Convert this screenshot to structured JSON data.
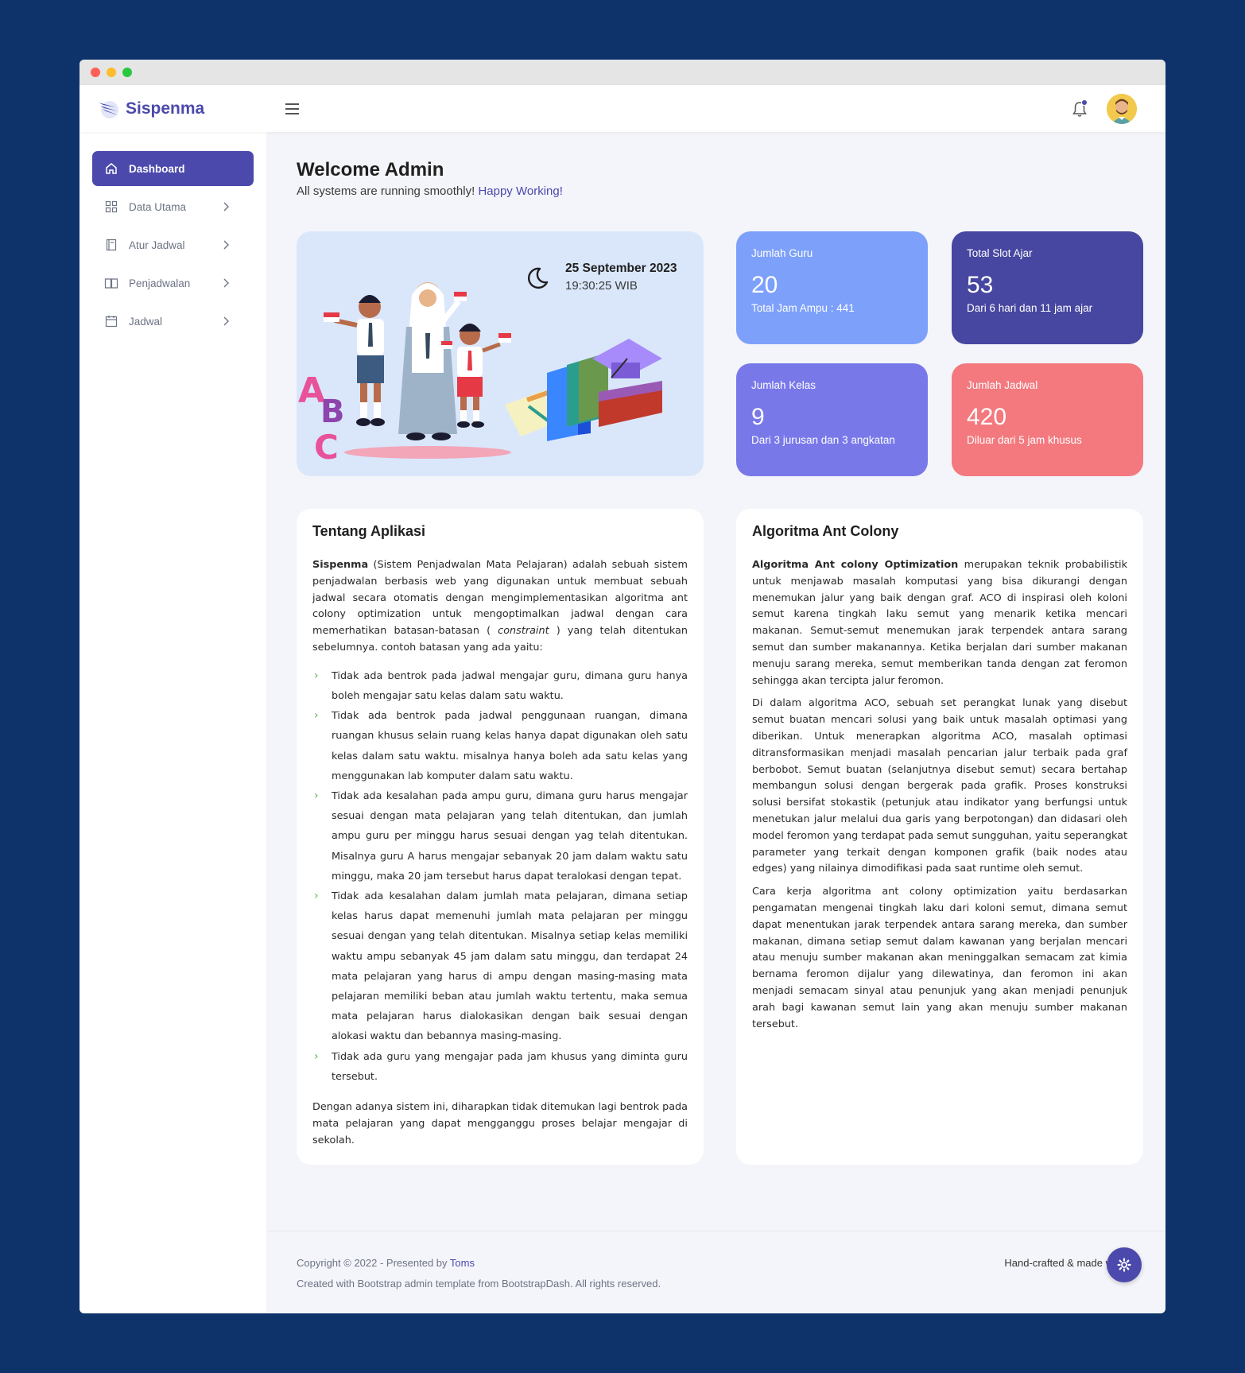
{
  "brand": {
    "name": "Sispenma"
  },
  "sidebar": {
    "items": [
      {
        "label": "Dashboard",
        "icon": "home-icon",
        "active": true
      },
      {
        "label": "Data Utama",
        "icon": "grid-icon"
      },
      {
        "label": "Atur Jadwal",
        "icon": "book-icon"
      },
      {
        "label": "Penjadwalan",
        "icon": "open-book-icon"
      },
      {
        "label": "Jadwal",
        "icon": "calendar-icon"
      }
    ]
  },
  "welcome": {
    "title": "Welcome Admin",
    "subtitle": "All systems are running smoothly!",
    "highlight": "Happy Working!"
  },
  "hero": {
    "date": "25 September 2023",
    "time": "19:30:25 WIB"
  },
  "stats": [
    {
      "label": "Jumlah Guru",
      "value": "20",
      "sub": "Total Jam Ampu : 441",
      "color": "#7da0fa"
    },
    {
      "label": "Total Slot Ajar",
      "value": "53",
      "sub": "Dari 6 hari dan 11 jam ajar",
      "color": "#4747a1"
    },
    {
      "label": "Jumlah Kelas",
      "value": "9",
      "sub": "Dari 3 jurusan dan 3 angkatan",
      "color": "#7978e9"
    },
    {
      "label": "Jumlah Jadwal",
      "value": "420",
      "sub": "Diluar dari 5 jam khusus",
      "color": "#f3797e"
    }
  ],
  "about": {
    "title": "Tentang Aplikasi",
    "intro_bold": "Sispenma",
    "intro_a": " (Sistem Penjadwalan Mata Pelajaran) adalah sebuah sistem penjadwalan berbasis web yang digunakan untuk membuat sebuah jadwal secara otomatis dengan mengimplementasikan algoritma ant colony optimization untuk mengoptimalkan jadwal dengan cara memerhatikan batasan-batasan ( ",
    "intro_italic": "constraint",
    "intro_b": " ) yang telah ditentukan sebelumnya. contoh batasan yang ada yaitu:",
    "list": [
      "Tidak ada bentrok pada jadwal mengajar guru, dimana guru hanya boleh mengajar satu kelas dalam satu waktu.",
      "Tidak ada bentrok pada jadwal penggunaan ruangan, dimana ruangan khusus selain ruang kelas hanya dapat digunakan oleh satu kelas dalam satu waktu. misalnya hanya boleh ada satu kelas yang menggunakan lab komputer dalam satu waktu.",
      "Tidak ada kesalahan pada ampu guru, dimana guru harus mengajar sesuai dengan mata pelajaran yang telah ditentukan, dan jumlah ampu guru per minggu harus sesuai dengan yag telah ditentukan. Misalnya guru A harus mengajar sebanyak 20 jam dalam waktu satu minggu, maka 20 jam tersebut harus dapat teralokasi dengan tepat.",
      "Tidak ada kesalahan dalam jumlah mata pelajaran, dimana setiap kelas harus dapat memenuhi jumlah mata pelajaran per minggu sesuai dengan yang telah ditentukan. Misalnya setiap kelas memiliki waktu ampu sebanyak 45 jam dalam satu minggu, dan terdapat 24 mata pelajaran yang harus di ampu dengan masing-masing mata pelajaran memiliki beban atau jumlah waktu tertentu, maka semua mata pelajaran harus dialokasikan dengan baik sesuai dengan alokasi waktu dan bebannya masing-masing.",
      "Tidak ada guru yang mengajar pada jam khusus yang diminta guru tersebut."
    ],
    "closing": "Dengan adanya sistem ini, diharapkan tidak ditemukan lagi bentrok pada mata pelajaran yang dapat mengganggu proses belajar mengajar di sekolah."
  },
  "aco": {
    "title": "Algoritma Ant Colony",
    "p1_bold": "Algoritma Ant colony Optimization",
    "p1": " merupakan teknik probabilistik untuk menjawab masalah komputasi yang bisa dikurangi dengan menemukan jalur yang baik dengan graf. ACO di inspirasi oleh koloni semut karena tingkah laku semut yang menarik ketika mencari makanan. Semut-semut menemukan jarak terpendek antara sarang semut dan sumber makanannya. Ketika berjalan dari sumber makanan menuju sarang mereka, semut memberikan tanda dengan zat feromon sehingga akan tercipta jalur feromon.",
    "p2": "Di dalam algoritma ACO, sebuah set perangkat lunak yang disebut semut buatan mencari solusi yang baik untuk masalah optimasi yang diberikan. Untuk menerapkan algoritma ACO, masalah optimasi ditransformasikan menjadi masalah pencarian jalur terbaik pada graf berbobot. Semut buatan (selanjutnya disebut semut) secara bertahap membangun solusi dengan bergerak pada grafik. Proses konstruksi solusi bersifat stokastik (petunjuk atau indikator yang berfungsi untuk menetukan jalur melalui dua garis yang berpotongan) dan didasari oleh model feromon yang terdapat pada semut sungguhan, yaitu seperangkat parameter yang terkait dengan komponen grafik (baik nodes atau edges) yang nilainya dimodifikasi pada saat runtime oleh semut.",
    "p3": "Cara kerja algoritma ant colony optimization yaitu berdasarkan pengamatan mengenai tingkah laku dari koloni semut, dimana semut dapat menentukan jarak terpendek antara sarang mereka, dan sumber makanan, dimana setiap semut dalam kawanan yang berjalan mencari atau menuju sumber makanan akan meninggalkan semacam zat kimia bernama feromon dijalur yang dilewatinya, dan feromon ini akan menjadi semacam sinyal atau penunjuk yang akan menjadi penunjuk arah bagi kawanan semut lain yang akan menuju sumber makanan tersebut."
  },
  "footer": {
    "copyright": "Copyright © 2022 - Presented by ",
    "author": "Toms",
    "credit": "Created with Bootstrap admin template from BootstrapDash. All rights reserved.",
    "handcrafted": "Hand-crafted & made w"
  },
  "colors": {
    "primary": "#4b49ac",
    "background": "#0d336a"
  }
}
